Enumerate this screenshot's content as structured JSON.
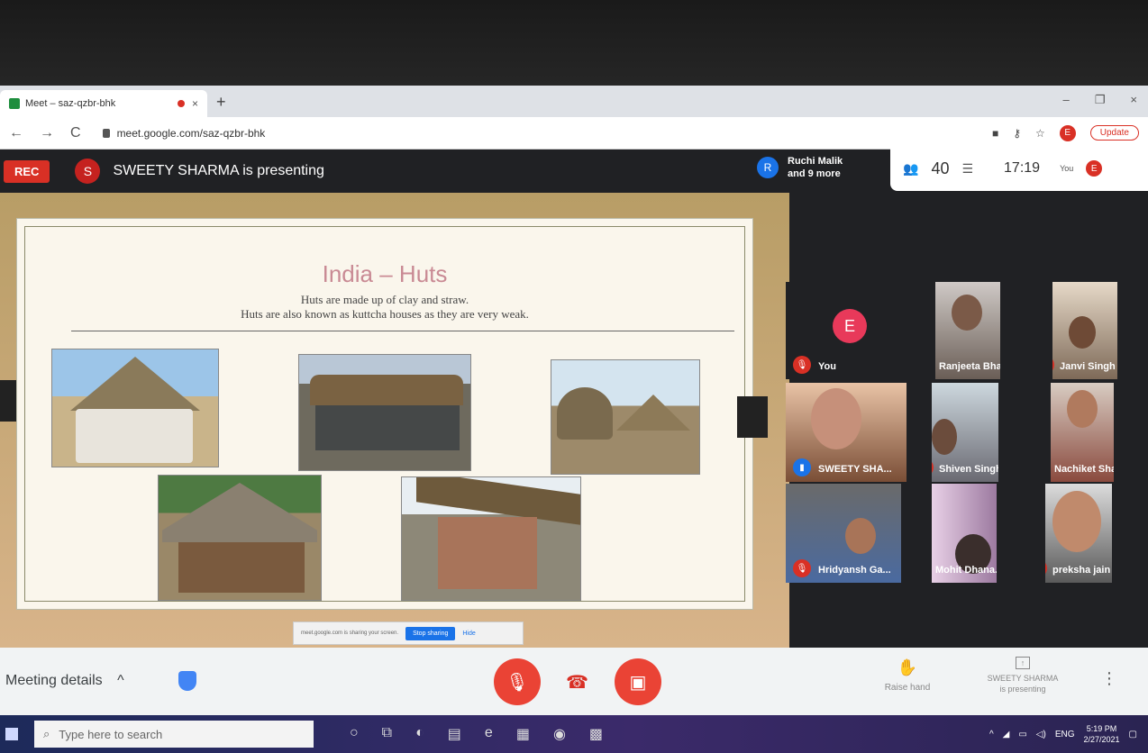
{
  "browser": {
    "tab_title": "Meet – saz-qzbr-bhk",
    "tab_close": "×",
    "new_tab": "+",
    "url": "meet.google.com/saz-qzbr-bhk",
    "back": "←",
    "forward": "→",
    "reload": "C",
    "profile_initial": "E",
    "update_label": "Update",
    "win_min": "–",
    "win_restore": "❐",
    "win_close": "×"
  },
  "meet": {
    "rec_label": "REC",
    "presenter_initial": "S",
    "presenting_text": "SWEETY SHARMA is presenting",
    "others_initial": "R",
    "others_line1": "Ruchi Malik",
    "others_line2": "and 9 more",
    "participant_count": "40",
    "time": "17:19",
    "you_label": "You",
    "you_initial": "E"
  },
  "slide": {
    "title": "India – Huts",
    "line1": "Huts are made up of clay and straw.",
    "line2": "Huts are also known as kuttcha houses as they are very weak.",
    "share_text": "meet.google.com is sharing your screen.",
    "stop_label": "Stop sharing",
    "hide_label": "Hide"
  },
  "participants": [
    {
      "name": "You",
      "initial": "E"
    },
    {
      "name": "Ranjeeta Bhat..."
    },
    {
      "name": "Janvi Singh"
    },
    {
      "name": "SWEETY SHA..."
    },
    {
      "name": "Shiven Singh"
    },
    {
      "name": "Nachiket Sha..."
    },
    {
      "name": "Hridyansh Ga..."
    },
    {
      "name": "Mohit Dhana..."
    },
    {
      "name": "preksha jain"
    }
  ],
  "bottom": {
    "meeting_details": "Meeting details",
    "chevron": "^",
    "raise_hand": "Raise hand",
    "presenting_line1": "SWEETY SHARMA",
    "presenting_line2": "is presenting",
    "more": "⋮"
  },
  "taskbar": {
    "search_placeholder": "Type here to search",
    "language": "ENG",
    "clock_time": "5:19 PM",
    "clock_date": "2/27/2021"
  },
  "colors": {
    "meet_dark": "#202124",
    "rec_red": "#d93025",
    "control_red": "#ea4335",
    "slide_title": "#c98a94"
  }
}
